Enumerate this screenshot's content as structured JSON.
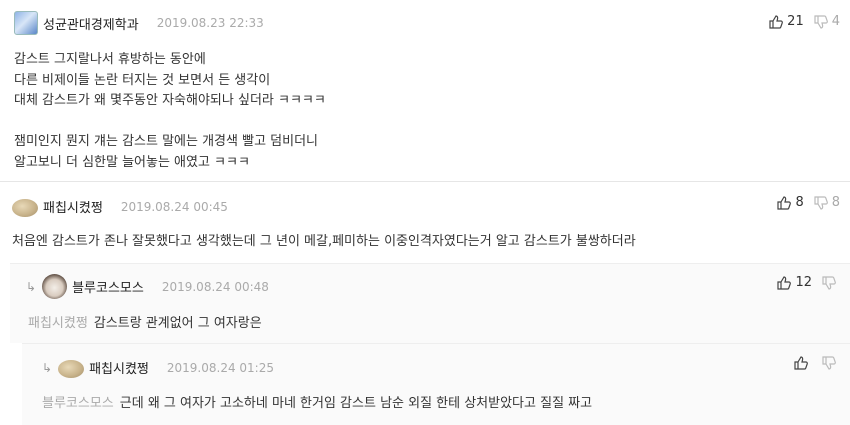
{
  "comments": [
    {
      "nickname": "성균관대경제학과",
      "date": "2019.08.23 22:33",
      "text": "감스트 그지랄나서 휴방하는 동안에\n다른 비제이들 논란 터지는 것 보면서 든 생각이\n대체 감스트가 왜 몇주동안 자숙해야되나 싶더라 ㅋㅋㅋㅋ\n\n잼미인지 뭔지 걔는 감스트 말에는 개경색 빨고 덤비더니\n알고보니 더 심한말 늘어놓는 애였고 ㅋㅋㅋ",
      "up": "21",
      "down": "4"
    },
    {
      "nickname": "패칩시켰쩡",
      "date": "2019.08.24 00:45",
      "text": "처음엔 감스트가 존나 잘못했다고 생각했는데 그 년이 메갈,페미하는 이중인격자였다는거 알고 감스트가 불쌍하더라",
      "up": "8",
      "down": "8"
    },
    {
      "nickname": "블루코스모스",
      "date": "2019.08.24 00:48",
      "reply_to": "패칩시켰쩡",
      "text": "감스트랑 관계없어 그 여자랑은",
      "up": "12",
      "down": ""
    },
    {
      "nickname": "패칩시켰쩡",
      "date": "2019.08.24 01:25",
      "reply_to": "블루코스모스",
      "text": "근데 왜 그 여자가 고소하네 마네 한거임 감스트 남순 외질 한테 상처받았다고 질질 짜고",
      "up": "",
      "down": ""
    }
  ],
  "icons": {
    "thumb_up": "thumbs-up-icon",
    "thumb_down": "thumbs-down-icon",
    "reply_arrow": "reply-arrow-icon"
  },
  "colors": {
    "date": "#aaaaaa",
    "reply_to": "#aaaaaa",
    "reply_bg": "#fafafa"
  }
}
